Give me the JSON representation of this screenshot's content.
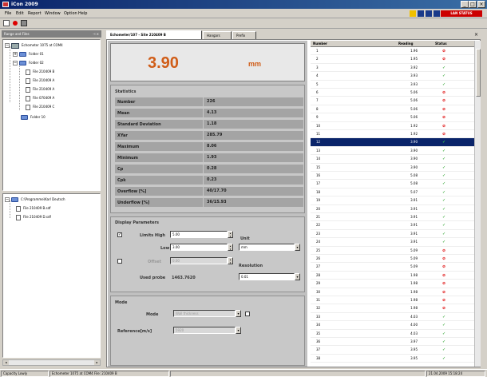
{
  "app": {
    "title": "iCon 2009"
  },
  "menu": {
    "items": [
      "File",
      "Edit",
      "Report",
      "Window",
      "Option",
      "Help"
    ]
  },
  "status_indicator": {
    "label": "LAN STATUS",
    "colors": [
      "#f0c000",
      "#1a3a8a",
      "#1a3a8a",
      "#1a3a8a"
    ]
  },
  "toolbar": {
    "icons": [
      "new-icon",
      "stop-icon",
      "print-icon"
    ]
  },
  "left_panel": {
    "title": "Range and Files",
    "tree1": {
      "root": "Echometer 1075 at COM4",
      "nodes": [
        "Folder 01",
        "Folder 02",
        "File 210409 B",
        "File 210409 A",
        "File 210409 A",
        "File 070409 A",
        "File 210409 C",
        "Folder 10"
      ]
    },
    "tree2": {
      "root": "C:\\Programme\\Karl Deutsch",
      "nodes": [
        "File 210409 B.sdf",
        "File 210409 D.sdf"
      ]
    }
  },
  "tabs": [
    {
      "label": "Echometer/107 - Site 210409 B"
    },
    {
      "label": "Hangars"
    },
    {
      "label": "Prefix"
    }
  ],
  "reading": {
    "value": "3.90",
    "unit": "mm"
  },
  "statistics": {
    "heading": "Statistics",
    "rows": [
      {
        "label": "Number",
        "value": "226"
      },
      {
        "label": "Mean",
        "value": "4.13"
      },
      {
        "label": "Standard Deviation",
        "value": "1.18"
      },
      {
        "label": "XYar",
        "value": "285.79"
      },
      {
        "label": "Maximum",
        "value": "8.06"
      },
      {
        "label": "Minimum",
        "value": "1.93"
      },
      {
        "label": "Cp",
        "value": "0.28"
      },
      {
        "label": "Cpk",
        "value": "0.23"
      },
      {
        "label": "Overflow [%]",
        "value": "40/17.70"
      },
      {
        "label": "Underflow [%]",
        "value": "36/15.93"
      }
    ]
  },
  "display_params": {
    "heading": "Display Parameters",
    "limits_high_label": "Limits High",
    "limits_high_value": "5.00",
    "low_label": "Low",
    "low_value": "3.00",
    "unit_label": "Unit",
    "unit_value": "mm",
    "offset_label": "Offset",
    "offset_value": "0.00",
    "resolution_label": "Resolution",
    "resolution_value": "0.01",
    "used_probe_label": "Used probe",
    "used_probe_value": "1463.7620",
    "limits_checked": "✓"
  },
  "mode_box": {
    "heading": "Mode",
    "mode_label": "Mode",
    "mode_value": "Wall thickness",
    "ref_label": "Reference[m/s]",
    "ref_value": "5920"
  },
  "table": {
    "headers": {
      "number": "Number",
      "reading": "Reading",
      "status": "Status"
    },
    "selected_index": 11,
    "rows": [
      {
        "n": "1",
        "r": "1.96",
        "s": "bad"
      },
      {
        "n": "2",
        "r": "1.95",
        "s": "bad"
      },
      {
        "n": "3",
        "r": "3.92",
        "s": "ok"
      },
      {
        "n": "4",
        "r": "3.93",
        "s": "ok"
      },
      {
        "n": "5",
        "r": "3.93",
        "s": "ok"
      },
      {
        "n": "6",
        "r": "5.06",
        "s": "bad"
      },
      {
        "n": "7",
        "r": "5.06",
        "s": "bad"
      },
      {
        "n": "8",
        "r": "5.06",
        "s": "bad"
      },
      {
        "n": "9",
        "r": "5.06",
        "s": "bad"
      },
      {
        "n": "10",
        "r": "1.92",
        "s": "bad"
      },
      {
        "n": "11",
        "r": "1.92",
        "s": "bad"
      },
      {
        "n": "12",
        "r": "3.90",
        "s": "ok"
      },
      {
        "n": "13",
        "r": "3.90",
        "s": "ok"
      },
      {
        "n": "14",
        "r": "3.90",
        "s": "ok"
      },
      {
        "n": "15",
        "r": "3.90",
        "s": "ok"
      },
      {
        "n": "16",
        "r": "5.08",
        "s": "ok"
      },
      {
        "n": "17",
        "r": "5.08",
        "s": "ok"
      },
      {
        "n": "18",
        "r": "5.07",
        "s": "ok"
      },
      {
        "n": "19",
        "r": "3.91",
        "s": "ok"
      },
      {
        "n": "20",
        "r": "3.91",
        "s": "ok"
      },
      {
        "n": "21",
        "r": "3.91",
        "s": "ok"
      },
      {
        "n": "22",
        "r": "3.91",
        "s": "ok"
      },
      {
        "n": "23",
        "r": "3.91",
        "s": "ok"
      },
      {
        "n": "24",
        "r": "3.91",
        "s": "ok"
      },
      {
        "n": "25",
        "r": "5.09",
        "s": "bad"
      },
      {
        "n": "26",
        "r": "5.09",
        "s": "bad"
      },
      {
        "n": "27",
        "r": "5.09",
        "s": "bad"
      },
      {
        "n": "28",
        "r": "1.98",
        "s": "bad"
      },
      {
        "n": "29",
        "r": "1.98",
        "s": "bad"
      },
      {
        "n": "30",
        "r": "1.98",
        "s": "bad"
      },
      {
        "n": "31",
        "r": "1.98",
        "s": "bad"
      },
      {
        "n": "32",
        "r": "1.98",
        "s": "bad"
      },
      {
        "n": "33",
        "r": "4.03",
        "s": "ok"
      },
      {
        "n": "34",
        "r": "4.00",
        "s": "ok"
      },
      {
        "n": "35",
        "r": "4.03",
        "s": "ok"
      },
      {
        "n": "36",
        "r": "3.97",
        "s": "ok"
      },
      {
        "n": "37",
        "r": "3.95",
        "s": "ok"
      },
      {
        "n": "38",
        "r": "3.95",
        "s": "ok"
      }
    ]
  },
  "status_bar": {
    "segments": [
      "Capacity Lowly",
      "Echometer 1075 at COM4 File: 210409 B",
      "",
      "21.04.2009 15:18:24"
    ]
  },
  "colors": {
    "accent": "#d05d18",
    "ok": "#1a9b1a",
    "bad": "#d00000",
    "selection": "#0a246a"
  }
}
